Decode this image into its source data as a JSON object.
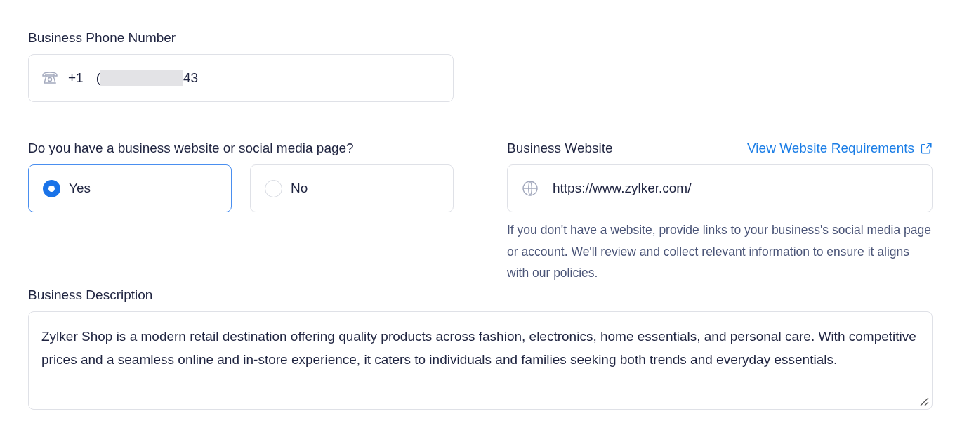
{
  "phone": {
    "label": "Business Phone Number",
    "country_code": "+1",
    "number_start": "(",
    "number_end": "43",
    "redacted": true
  },
  "website_question": {
    "label": "Do you have a business website or social media page?",
    "options": [
      {
        "label": "Yes",
        "selected": true
      },
      {
        "label": "No",
        "selected": false
      }
    ]
  },
  "website": {
    "label": "Business Website",
    "link": "View Website Requirements",
    "value": "https://www.zylker.com/",
    "help": "If you don't have a website, provide links to your business's social media page or account. We'll review and collect relevant information to ensure it aligns with our policies."
  },
  "description": {
    "label": "Business Description",
    "value": "Zylker Shop is a modern retail destination offering quality products across fashion, electronics, home essentials, and personal care. With competitive prices and a seamless online and in-store experience, it caters to individuals and families seeking both trends and everyday essentials."
  }
}
